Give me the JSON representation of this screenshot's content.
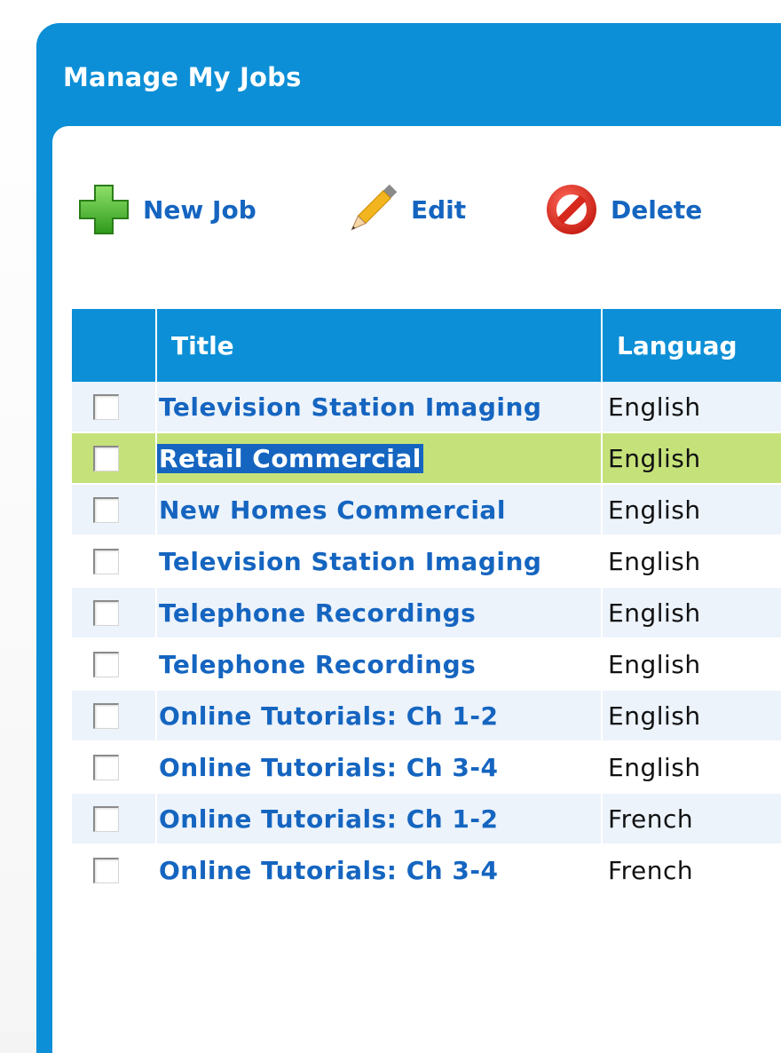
{
  "panel": {
    "title": "Manage My Jobs"
  },
  "toolbar": {
    "new_label": "New Job",
    "edit_label": "Edit",
    "delete_label": "Delete"
  },
  "table": {
    "headers": {
      "title": "Title",
      "language": "Languag"
    },
    "rows": [
      {
        "title": "Television Station Imaging",
        "language": "English",
        "checked": false
      },
      {
        "title": "Retail Commercial",
        "language": "English",
        "checked": false,
        "selected": true
      },
      {
        "title": "New Homes Commercial",
        "language": "English",
        "checked": false
      },
      {
        "title": "Television Station Imaging",
        "language": "English",
        "checked": false
      },
      {
        "title": "Telephone Recordings",
        "language": "English",
        "checked": false
      },
      {
        "title": "Telephone Recordings",
        "language": "English",
        "checked": false
      },
      {
        "title": "Online Tutorials: Ch 1-2",
        "language": "English",
        "checked": false
      },
      {
        "title": "Online Tutorials: Ch 3-4",
        "language": "English",
        "checked": false
      },
      {
        "title": "Online Tutorials: Ch 1-2",
        "language": "French",
        "checked": false
      },
      {
        "title": "Online Tutorials: Ch 3-4",
        "language": "French",
        "checked": false
      }
    ]
  },
  "colors": {
    "panel_blue": "#0c8fd6",
    "link_blue": "#1565c0",
    "selected_row": "#c5e27a",
    "alt_row": "#ecf3fb"
  },
  "icons": {
    "new": "green-plus-icon",
    "edit": "pencil-icon",
    "delete": "no-entry-icon"
  }
}
